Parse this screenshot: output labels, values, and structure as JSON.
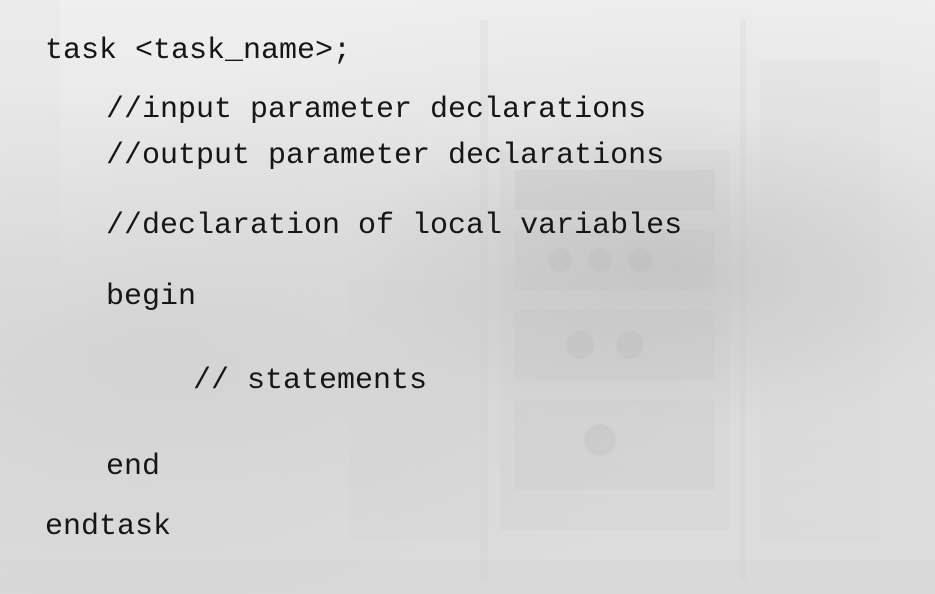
{
  "code_lines": [
    "task <task_name>;",
    "//input parameter declarations",
    "//output parameter declarations",
    "//declaration of local variables",
    "begin",
    "// statements",
    "end",
    "endtask"
  ]
}
